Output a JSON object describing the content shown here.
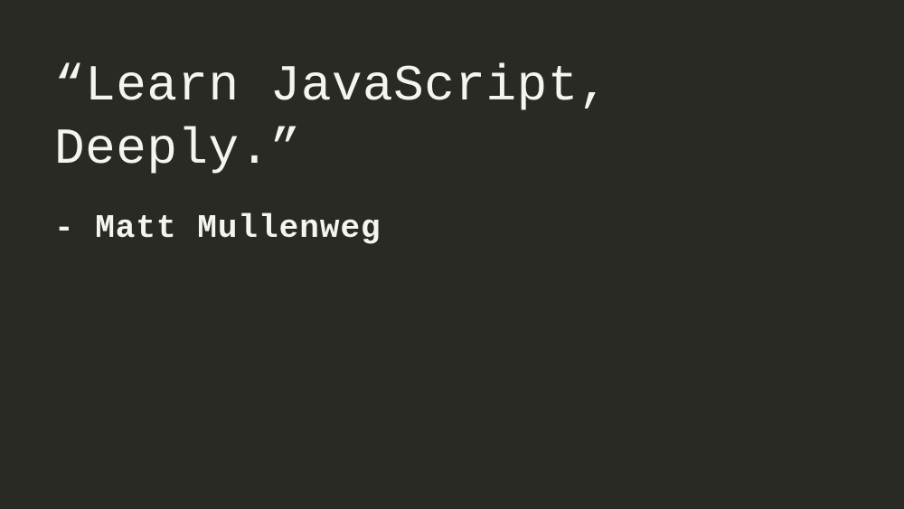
{
  "slide": {
    "quote": "“Learn JavaScript, Deeply.”",
    "attribution": "- Matt Mullenweg"
  },
  "colors": {
    "background": "#2a2a25",
    "text": "#f5f5f0"
  }
}
